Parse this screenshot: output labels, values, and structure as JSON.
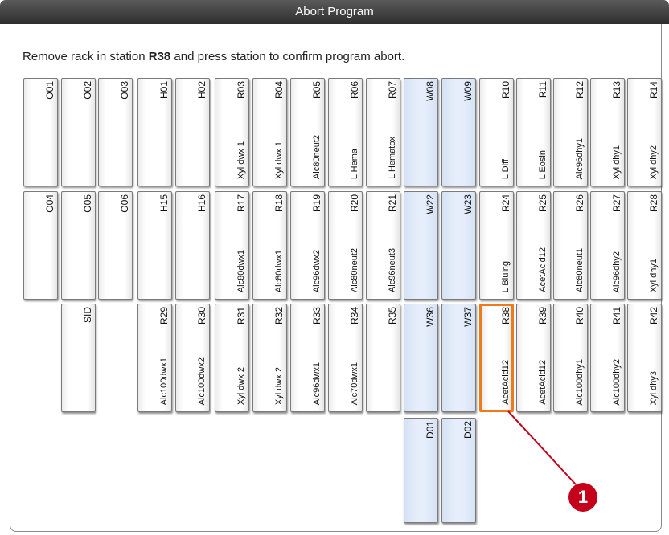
{
  "window": {
    "title": "Abort Program"
  },
  "instruction": {
    "prefix": "Remove rack in station ",
    "station": "R38",
    "suffix": " and press station to confirm program abort."
  },
  "callout": {
    "number": "1"
  },
  "colors": {
    "selected_border": "#f07a1a",
    "water_fill": "#e6eefb",
    "callout": "#c4001a"
  },
  "stations": [
    {
      "id": "O01",
      "reagent": ""
    },
    {
      "id": "O02",
      "reagent": ""
    },
    {
      "id": "O03",
      "reagent": ""
    },
    {
      "id": "H01",
      "reagent": ""
    },
    {
      "id": "H02",
      "reagent": ""
    },
    {
      "id": "R03",
      "reagent": "Xyl dwx 1"
    },
    {
      "id": "R04",
      "reagent": "Xyl dwx 1"
    },
    {
      "id": "R05",
      "reagent": "Alc80neut2"
    },
    {
      "id": "R06",
      "reagent": "L Hema"
    },
    {
      "id": "R07",
      "reagent": "L Hematox"
    },
    {
      "id": "W08",
      "reagent": ""
    },
    {
      "id": "W09",
      "reagent": ""
    },
    {
      "id": "R10",
      "reagent": "L Diff"
    },
    {
      "id": "R11",
      "reagent": "L Eosin"
    },
    {
      "id": "R12",
      "reagent": "Alc96dhy1"
    },
    {
      "id": "R13",
      "reagent": "Xyl dhy1"
    },
    {
      "id": "R14",
      "reagent": "Xyl dhy2"
    },
    {
      "id": "O04",
      "reagent": ""
    },
    {
      "id": "O05",
      "reagent": ""
    },
    {
      "id": "O06",
      "reagent": ""
    },
    {
      "id": "H15",
      "reagent": ""
    },
    {
      "id": "H16",
      "reagent": ""
    },
    {
      "id": "R17",
      "reagent": "Alc80dwx1"
    },
    {
      "id": "R18",
      "reagent": "Alc80dwx1"
    },
    {
      "id": "R19",
      "reagent": "Alc96dwx2"
    },
    {
      "id": "R20",
      "reagent": "Alc80neut2"
    },
    {
      "id": "R21",
      "reagent": "Alc96neut3"
    },
    {
      "id": "W22",
      "reagent": ""
    },
    {
      "id": "W23",
      "reagent": ""
    },
    {
      "id": "R24",
      "reagent": "L Bluing"
    },
    {
      "id": "R25",
      "reagent": "AcetAcid12"
    },
    {
      "id": "R26",
      "reagent": "Alc80neut1"
    },
    {
      "id": "R27",
      "reagent": "Alc96dhy2"
    },
    {
      "id": "R28",
      "reagent": "Xyl dhy1"
    },
    {
      "id": "SID",
      "reagent": ""
    },
    {
      "id": "R29",
      "reagent": "Alc100dwx1"
    },
    {
      "id": "R30",
      "reagent": "Alc100dwx2"
    },
    {
      "id": "R31",
      "reagent": "Xyl dwx 2"
    },
    {
      "id": "R32",
      "reagent": "Xyl dwx 2"
    },
    {
      "id": "R33",
      "reagent": "Alc96dwx1"
    },
    {
      "id": "R34",
      "reagent": "Alc70dwx1"
    },
    {
      "id": "R35",
      "reagent": ""
    },
    {
      "id": "W36",
      "reagent": ""
    },
    {
      "id": "W37",
      "reagent": ""
    },
    {
      "id": "R38",
      "reagent": "AcetAcid12"
    },
    {
      "id": "R39",
      "reagent": "AcetAcid12"
    },
    {
      "id": "R40",
      "reagent": "Alc100dhy1"
    },
    {
      "id": "R41",
      "reagent": "Alc100dhy2"
    },
    {
      "id": "R42",
      "reagent": "Xyl dhy3"
    },
    {
      "id": "D01",
      "reagent": ""
    },
    {
      "id": "D02",
      "reagent": ""
    }
  ]
}
